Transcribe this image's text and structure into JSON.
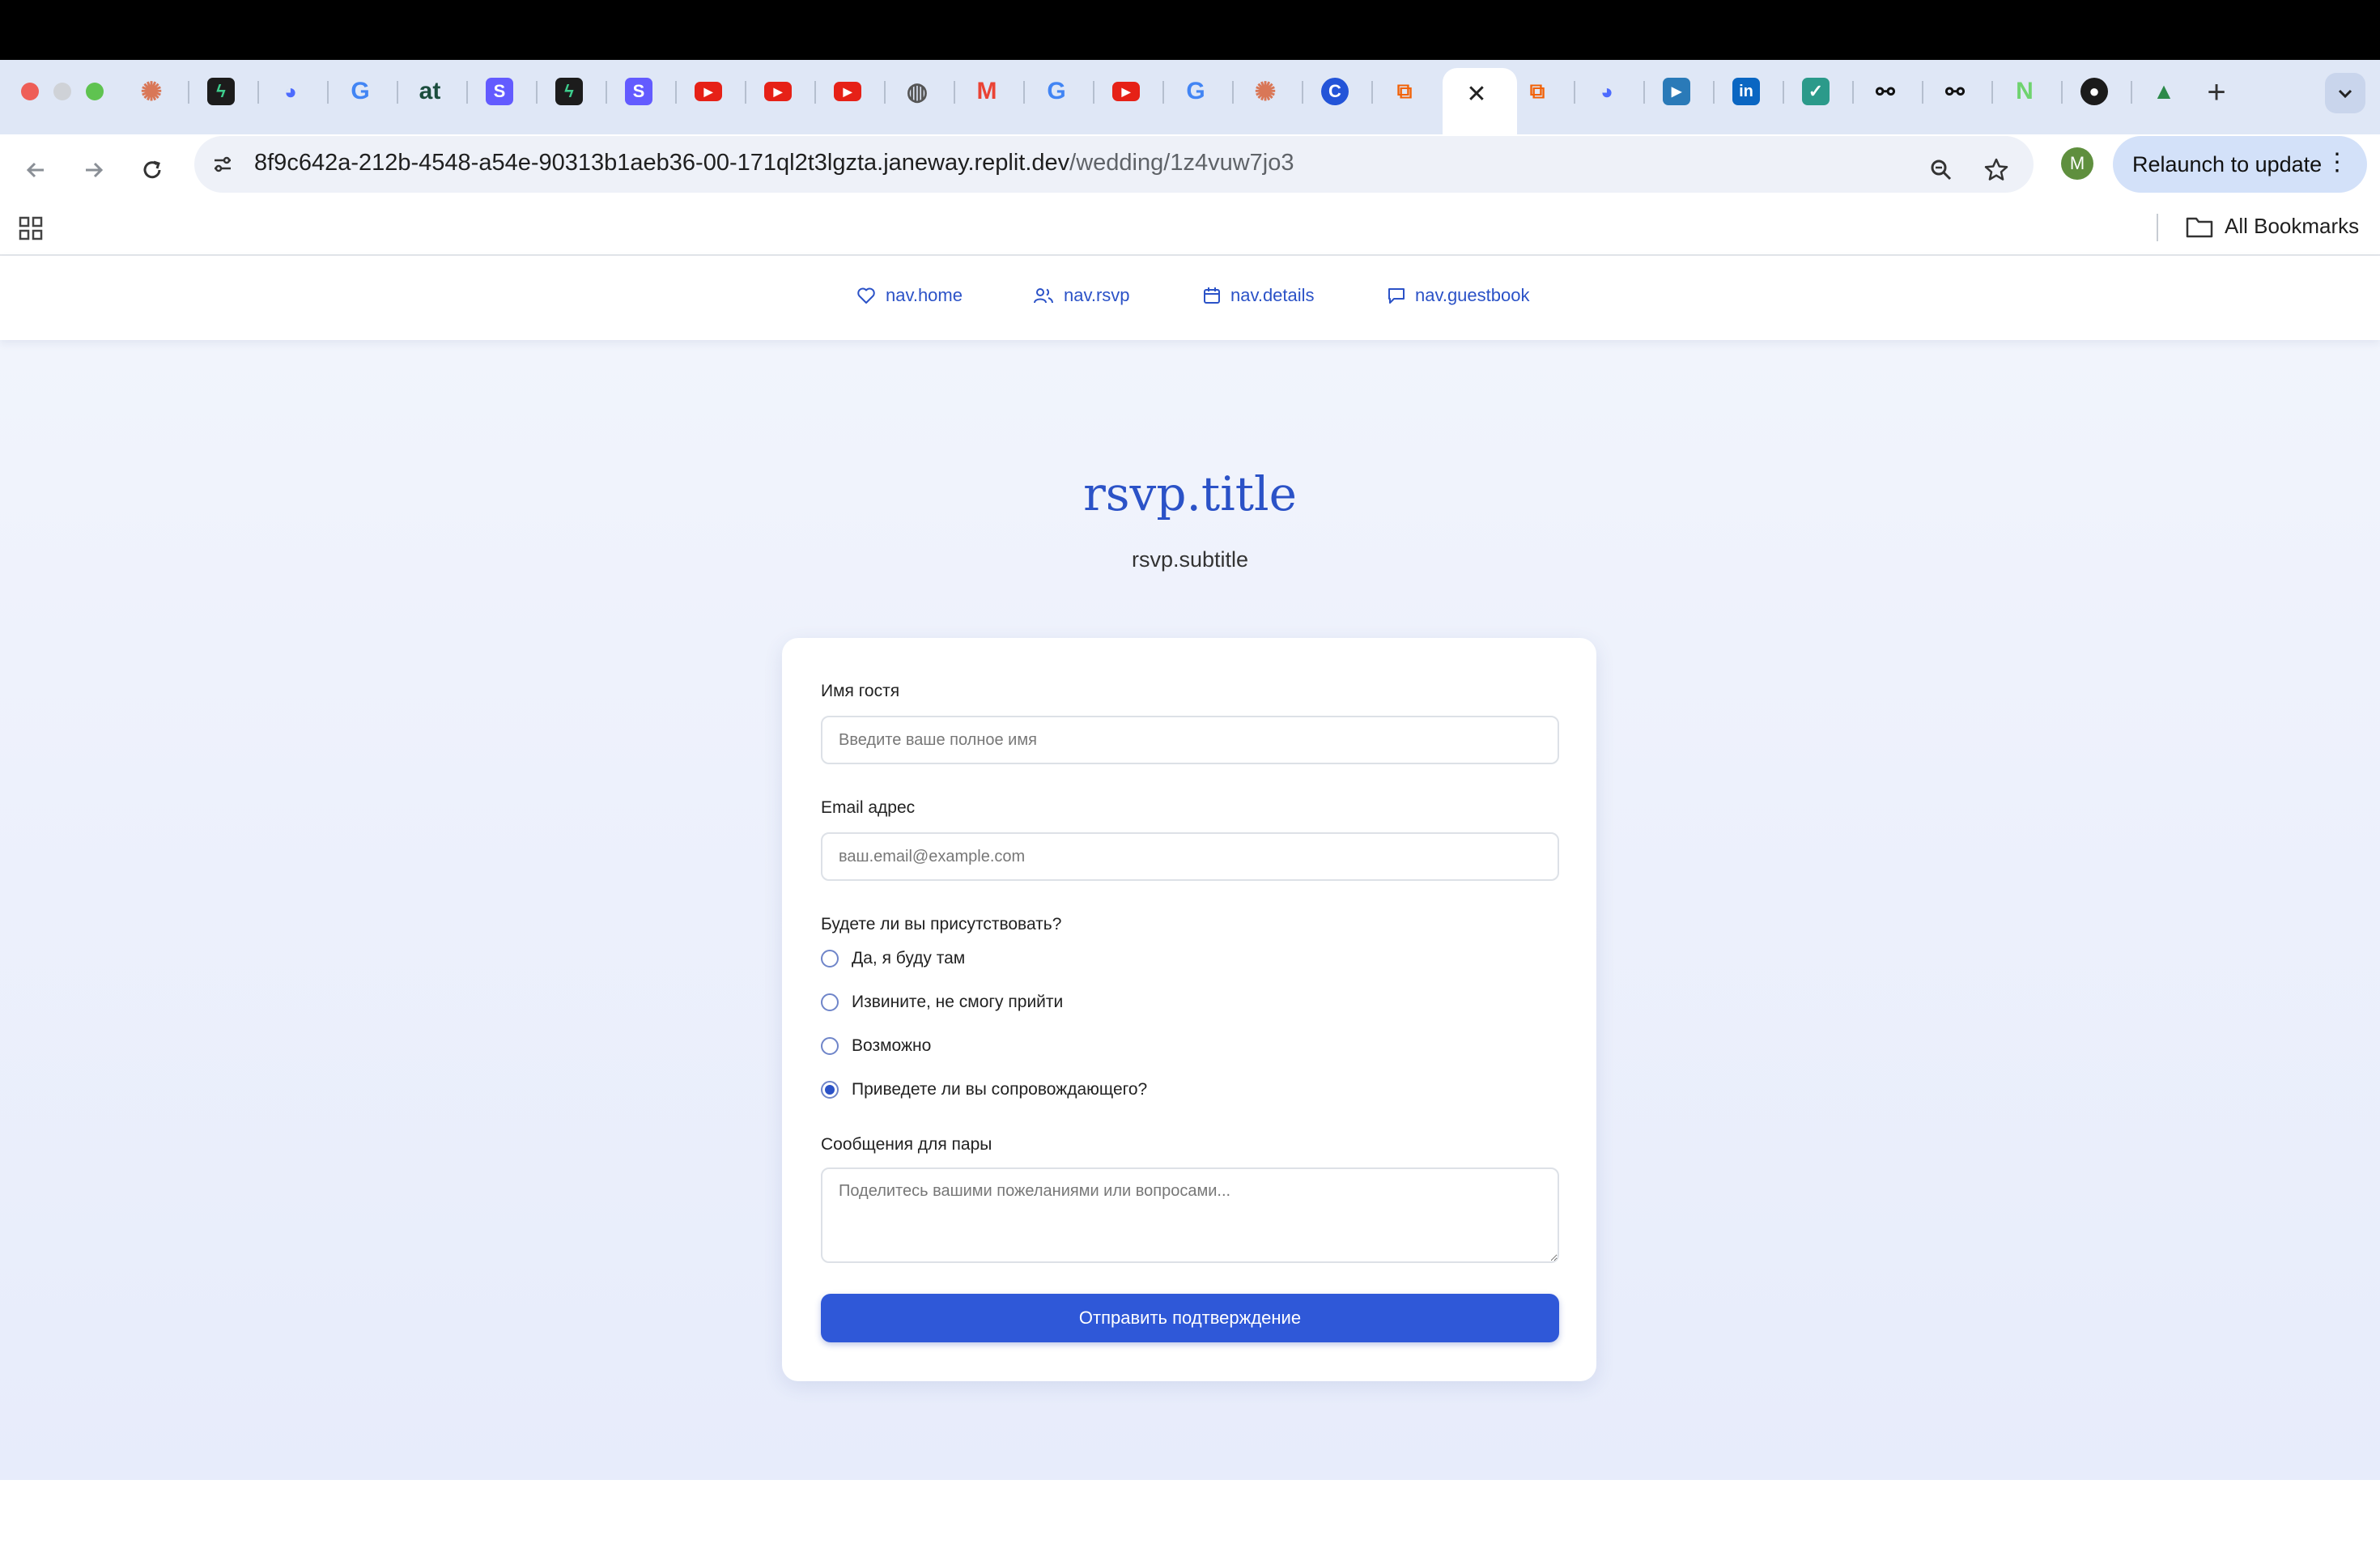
{
  "browser": {
    "address_host": "8f9c642a-212b-4548-a54e-90313b1aeb36-00-171ql2t3lgzta.janeway.replit.dev",
    "address_path": "/wedding/1z4vuw7jo3",
    "relaunch_label": "Relaunch to update",
    "profile_initial": "M",
    "bookmarks_label": "All Bookmarks",
    "tab_icons": [
      "claude-icon",
      "supabase-icon",
      "deepseek-icon",
      "google-icon",
      "at-icon",
      "stripe-icon",
      "supabase-icon",
      "stripe-icon",
      "youtube-icon",
      "youtube-icon",
      "youtube-icon",
      "globe-icon",
      "gmail-icon",
      "google-icon",
      "youtube-icon",
      "google-icon",
      "claude-icon",
      "c-icon",
      "replit-icon",
      "replit-icon",
      "deepseek-icon",
      "video-icon",
      "linkedin-icon",
      "tasks-icon",
      "n8n-icon",
      "n8n-icon",
      "notion-icon",
      "github-icon",
      "app-icon"
    ]
  },
  "nav": {
    "home": "nav.home",
    "rsvp": "nav.rsvp",
    "details": "nav.details",
    "guestbook": "nav.guestbook"
  },
  "header": {
    "title": "rsvp.title",
    "subtitle": "rsvp.subtitle"
  },
  "form": {
    "name_label": "Имя гостя",
    "name_placeholder": "Введите ваше полное имя",
    "email_label": "Email адрес",
    "email_placeholder": "ваш.email@example.com",
    "attend_label": "Будете ли вы присутствовать?",
    "options": [
      {
        "label": "Да, я буду там",
        "checked": false
      },
      {
        "label": "Извините, не смогу прийти",
        "checked": false
      },
      {
        "label": "Возможно",
        "checked": false
      },
      {
        "label": "Приведете ли вы сопровождающего?",
        "checked": true
      }
    ],
    "message_label": "Сообщения для пары",
    "message_placeholder": "Поделитесь вашими пожеланиями или вопросами...",
    "submit_label": "Отправить подтверждение"
  },
  "colors": {
    "accent": "#2b52c7",
    "button": "#2f58d8"
  }
}
